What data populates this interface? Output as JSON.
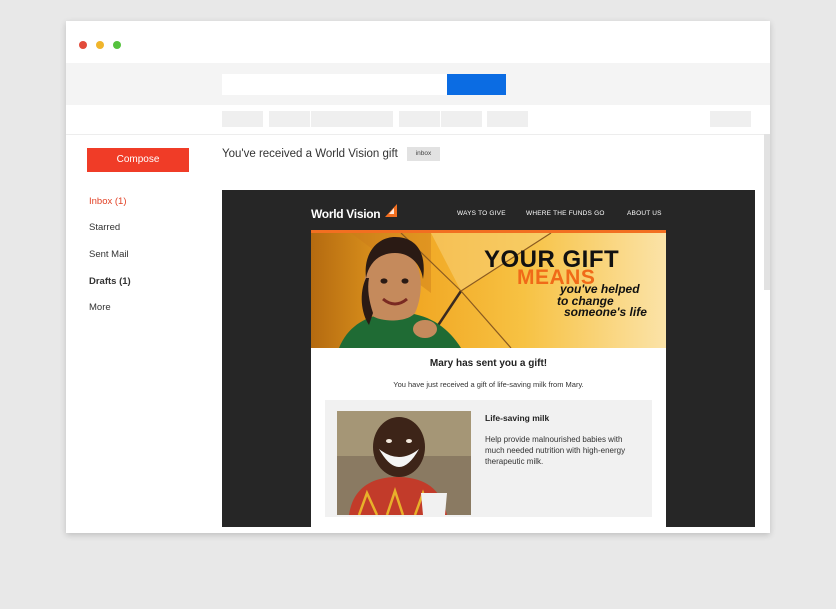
{
  "window": {
    "traffic_lights": [
      "#e24b3b",
      "#f0b52b",
      "#55c23d"
    ]
  },
  "search": {
    "placeholder": ""
  },
  "sidebar": {
    "compose_label": "Compose",
    "items": [
      {
        "label": "Inbox (1)"
      },
      {
        "label": "Starred"
      },
      {
        "label": "Sent Mail"
      },
      {
        "label": "Drafts (1)"
      },
      {
        "label": "More"
      }
    ]
  },
  "message": {
    "subject": "You've received a World Vision gift",
    "label": "inbox"
  },
  "email": {
    "logo_text": "World Vision",
    "nav": [
      "WAYS TO GIVE",
      "WHERE THE FUNDS GO",
      "ABOUT US"
    ],
    "hero": {
      "line1": "YOUR GIFT",
      "line2": "MEANS",
      "line3": "you've helped",
      "line4": "to change",
      "line5": "someone's life"
    },
    "title": "Mary has sent you a gift!",
    "subtitle": "You have just received a gift of life-saving milk from Mary.",
    "product": {
      "title": "Life-saving milk",
      "description": "Help provide malnourished babies with much needed nutrition with high-energy therapeutic milk."
    },
    "brand_color": "#f26f21"
  },
  "colors": {
    "accent": "#0b6ce3",
    "compose": "#f03c27",
    "active_nav": "#e24226"
  }
}
